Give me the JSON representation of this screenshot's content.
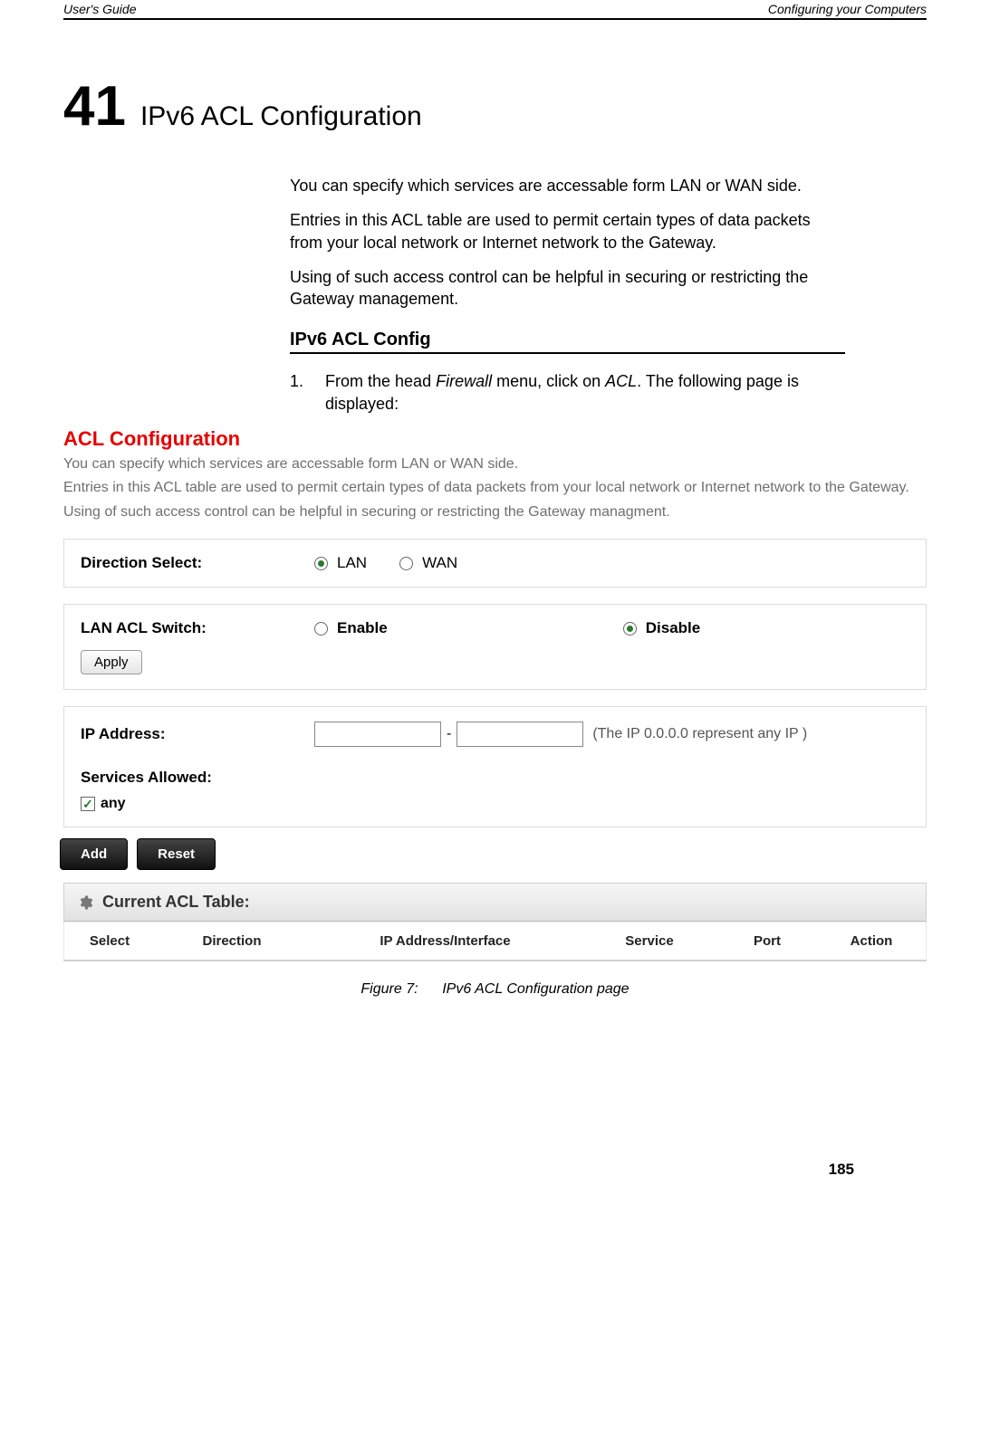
{
  "header": {
    "left": "User's Guide",
    "right": "Configuring your Computers"
  },
  "chapter": {
    "number": "41",
    "title": "IPv6 ACL Configuration"
  },
  "intro": {
    "p1": "You can specify which services are accessable form LAN or WAN side.",
    "p2": "Entries in this ACL table are used to permit certain types of data packets from your local network or Internet network to the Gateway.",
    "p3": "Using of such access control can be helpful in securing or restricting the Gateway management."
  },
  "section_heading": "IPv6 ACL Config",
  "step1": {
    "num": "1.",
    "before": "From the head ",
    "firewall": "Firewall",
    "mid": " menu, click on ",
    "acl": "ACL",
    "after": ". The following page is displayed:"
  },
  "screenshot": {
    "title": "ACL Configuration",
    "line1": "You can specify which services are accessable form LAN or WAN side.",
    "line2": "Entries in this ACL table are used to permit certain types of data packets from your local network or Internet network to the Gateway.",
    "line3": "Using of such access control can be helpful in securing or restricting the Gateway managment.",
    "direction_label": "Direction Select:",
    "direction_options": {
      "lan": "LAN",
      "wan": "WAN"
    },
    "direction_selected": "LAN",
    "lan_switch_label": "LAN ACL Switch:",
    "lan_switch_options": {
      "enable": "Enable",
      "disable": "Disable"
    },
    "lan_switch_selected": "Disable",
    "apply_label": "Apply",
    "ip_label": "IP Address:",
    "ip_from": "",
    "ip_dash": "-",
    "ip_to": "",
    "ip_hint": "(The IP 0.0.0.0 represent any IP )",
    "services_label": "Services Allowed:",
    "any_checked": true,
    "any_label": "any",
    "add_label": "Add",
    "reset_label": "Reset",
    "table_title": "Current ACL Table:",
    "columns": {
      "select": "Select",
      "direction": "Direction",
      "ip": "IP Address/Interface",
      "service": "Service",
      "port": "Port",
      "action": "Action"
    }
  },
  "figure_caption_label": "Figure 7:",
  "figure_caption_text": "IPv6 ACL  Configuration  page",
  "page_number": "185"
}
